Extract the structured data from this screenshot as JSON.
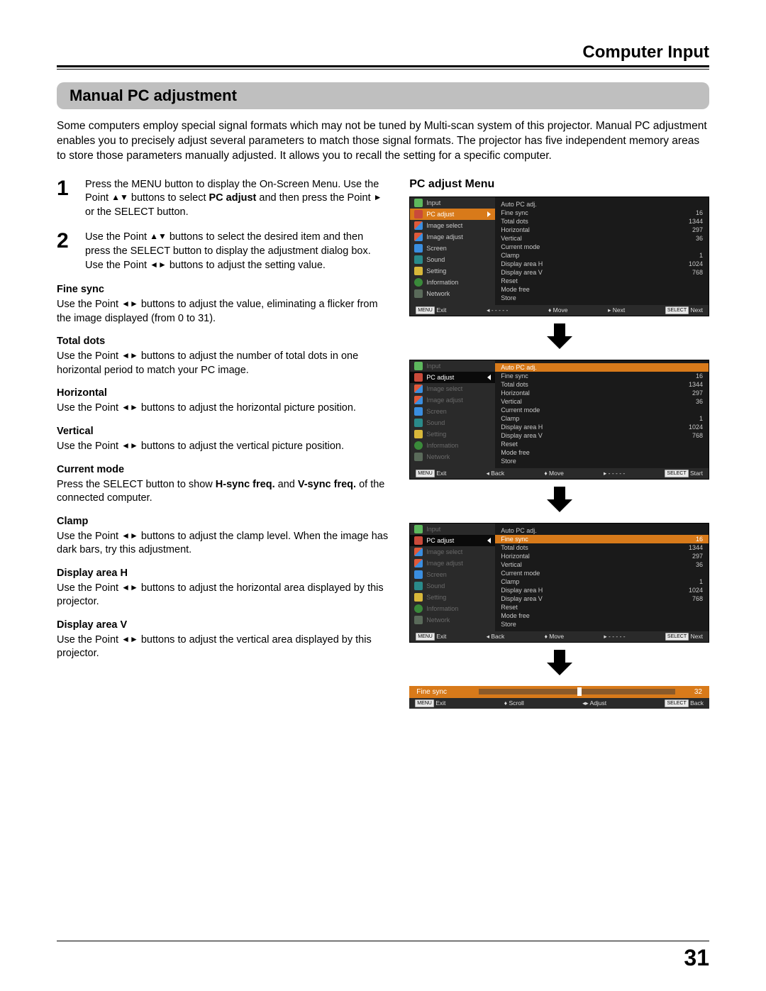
{
  "header": "Computer Input",
  "section_title": "Manual PC adjustment",
  "intro": "Some computers employ special signal formats which may not be tuned by Multi-scan system of this projector. Manual PC adjustment enables you to precisely adjust several parameters to match those signal formats. The projector has five independent memory areas to store those parameters manually adjusted. It allows you to recall the setting for a specific computer.",
  "steps": [
    {
      "num": "1",
      "pre": "Press the MENU button to display the On-Screen Menu. Use the Point ",
      "mid1": " buttons to select ",
      "bold1": "PC adjust",
      "mid2": " and then press the Point ",
      "post": " or the SELECT button."
    },
    {
      "num": "2",
      "pre": "Use the Point ",
      "mid1": " buttons to select  the desired item and then press the SELECT button to display the adjustment dialog box. Use the Point ",
      "post": " buttons to adjust the setting value."
    }
  ],
  "params": [
    {
      "title": "Fine sync",
      "body_pre": "Use the Point ",
      "body_post": " buttons to adjust the value, eliminating a flicker from the image displayed (from 0 to 31)."
    },
    {
      "title": "Total dots",
      "body_pre": "Use the Point ",
      "body_post": " buttons to adjust the number of total dots in one horizontal period to match your PC image."
    },
    {
      "title": "Horizontal",
      "body_pre": "Use the Point ",
      "body_post": " buttons to adjust the horizontal picture position."
    },
    {
      "title": "Vertical",
      "body_pre": "Use the Point ",
      "body_post": " buttons to adjust the vertical picture position."
    },
    {
      "title": "Current mode",
      "body_pre": "Press the SELECT button to show ",
      "bold1": "H-sync freq.",
      "mid": " and ",
      "bold2": "V-sync freq.",
      "body_post": " of the connected computer."
    },
    {
      "title": "Clamp",
      "body_pre": "Use the Point ",
      "body_post": " buttons to adjust the clamp level. When the image has dark bars, try this adjustment."
    },
    {
      "title": "Display area H",
      "body_pre": "Use the Point ",
      "body_post": " buttons to adjust the horizontal area displayed by this projector."
    },
    {
      "title": "Display area V",
      "body_pre": "Use the Point ",
      "body_post": " buttons to adjust the vertical area displayed by this projector."
    }
  ],
  "right_title": "PC adjust Menu",
  "menu_items": [
    "Input",
    "PC adjust",
    "Image select",
    "Image adjust",
    "Screen",
    "Sound",
    "Setting",
    "Information",
    "Network"
  ],
  "pv_list": [
    {
      "name": "Auto PC adj.",
      "val": ""
    },
    {
      "name": "Fine sync",
      "val": "16"
    },
    {
      "name": "Total dots",
      "val": "1344"
    },
    {
      "name": "Horizontal",
      "val": "297"
    },
    {
      "name": "Vertical",
      "val": "36"
    },
    {
      "name": "Current mode",
      "val": ""
    },
    {
      "name": "Clamp",
      "val": "1"
    },
    {
      "name": "Display area H",
      "val": "1024"
    },
    {
      "name": "Display area V",
      "val": "768"
    },
    {
      "name": "Reset",
      "val": ""
    },
    {
      "name": "Mode free",
      "val": ""
    },
    {
      "name": "Store",
      "val": ""
    }
  ],
  "footer_keys": {
    "menu": "MENU",
    "select": "SELECT",
    "exit": "Exit",
    "back": "Back",
    "move": "Move",
    "next": "Next",
    "start": "Start",
    "scroll": "Scroll",
    "adjust": "Adjust",
    "dashes": "- - - - -"
  },
  "adjust_bar": {
    "label": "Fine sync",
    "value": "32"
  },
  "page_number": "31"
}
